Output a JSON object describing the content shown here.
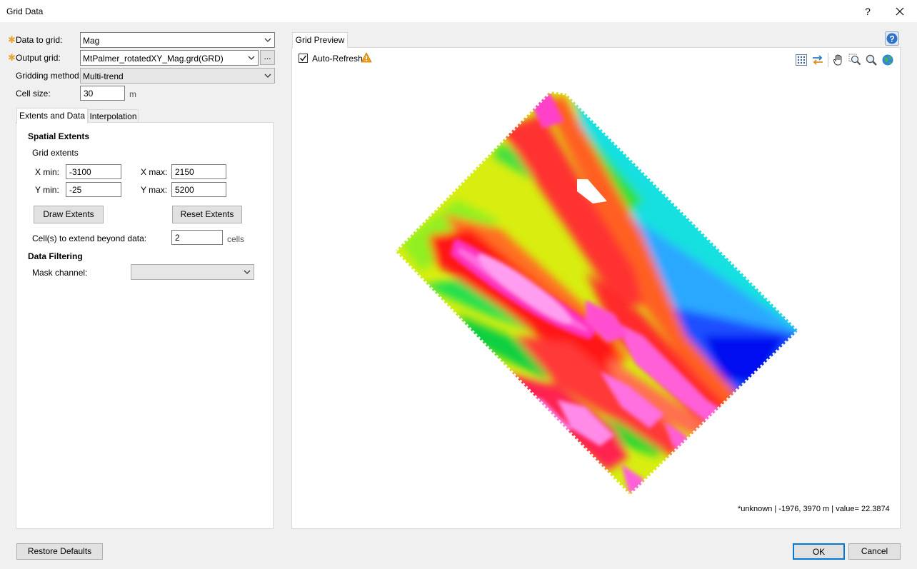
{
  "window": {
    "title": "Grid Data",
    "help_label": "?",
    "close_label": "✕"
  },
  "form": {
    "data_to_grid": {
      "label": "Data to grid:",
      "value": "Mag"
    },
    "output_grid": {
      "label": "Output grid:",
      "value": "MtPalmer_rotatedXY_Mag.grd(GRD)",
      "browse_label": "..."
    },
    "gridding_method": {
      "label": "Gridding method:",
      "value": "Multi-trend"
    },
    "cell_size": {
      "label": "Cell size:",
      "value": "30",
      "unit": "m"
    }
  },
  "tabs": [
    {
      "label": "Extents and Data",
      "active": true
    },
    {
      "label": "Interpolation",
      "active": false
    }
  ],
  "extents": {
    "section_title": "Spatial Extents",
    "grid_extents_label": "Grid extents",
    "xmin_label": "X min:",
    "xmin": "-3100",
    "xmax_label": "X max:",
    "xmax": "2150",
    "ymin_label": "Y min:",
    "ymin": "-25",
    "ymax_label": "Y max:",
    "ymax": "5200",
    "draw_extents_label": "Draw Extents",
    "reset_extents_label": "Reset Extents",
    "extend_label": "Cell(s) to extend beyond data:",
    "extend_value": "2",
    "extend_unit": "cells"
  },
  "filtering": {
    "section_title": "Data Filtering",
    "mask_label": "Mask channel:",
    "mask_value": ""
  },
  "preview": {
    "tab_label": "Grid Preview",
    "auto_refresh_label": "Auto-Refresh",
    "auto_refresh_checked": true,
    "status": "*unknown |  -1976, 3970 m |  value= 22.3874",
    "toolbar_icons": [
      "grid-points-icon",
      "swap-arrows-icon",
      "hand-pan-icon",
      "zoom-extent-icon",
      "zoom-icon",
      "globe-icon"
    ],
    "colors": {
      "low": "#0000ff",
      "mid": "#00ff00",
      "high": "#ff0000",
      "max": "#ff80ff"
    }
  },
  "footer": {
    "restore_label": "Restore Defaults",
    "ok_label": "OK",
    "cancel_label": "Cancel"
  }
}
